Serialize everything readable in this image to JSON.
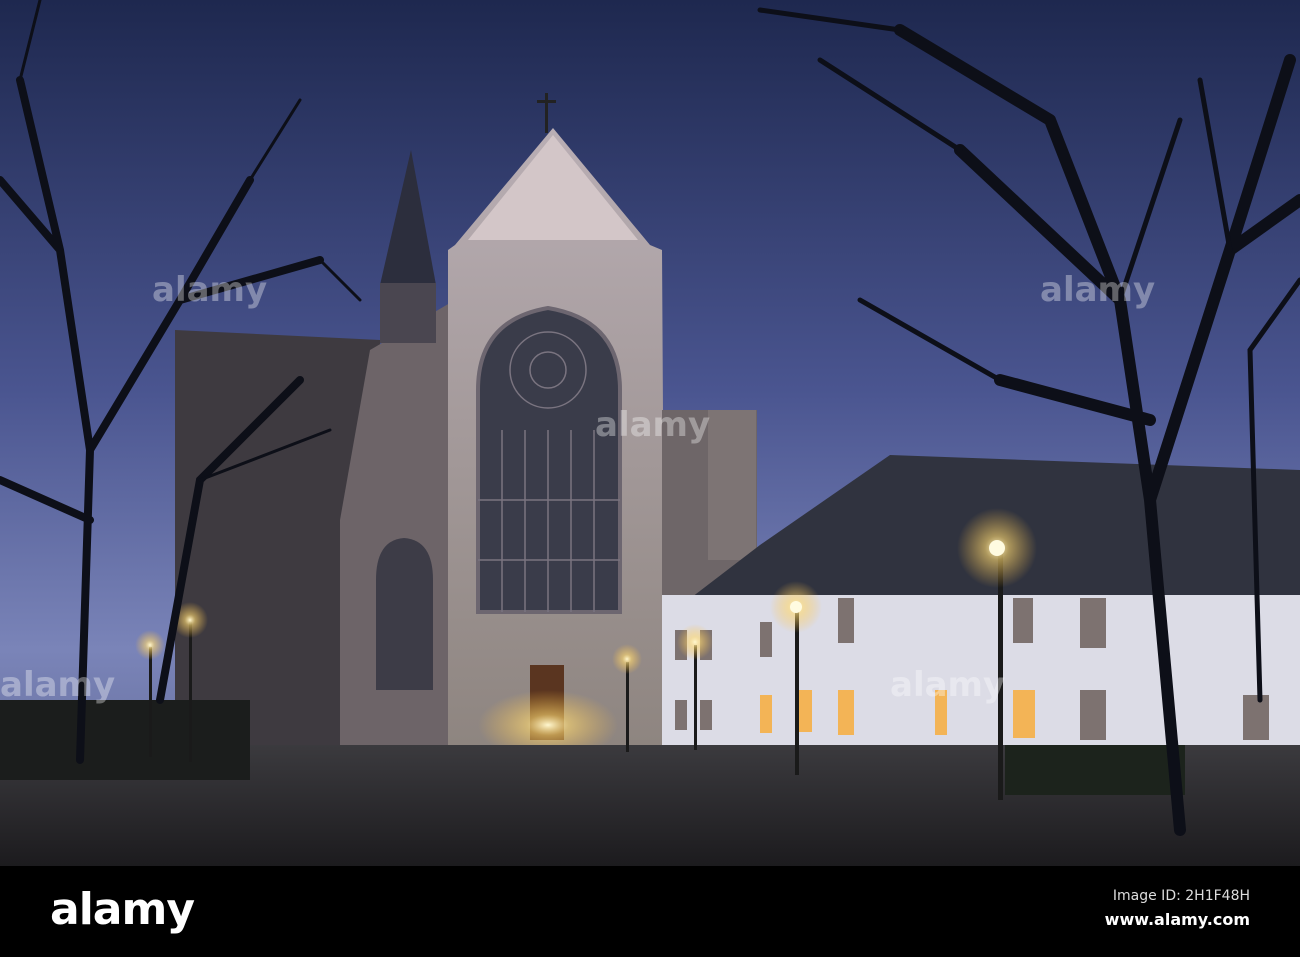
{
  "watermark": {
    "brand": "alamy"
  },
  "footer": {
    "logo": "alamy",
    "image_id": "Image ID: 2H1F48H",
    "url": "www.alamy.com"
  },
  "colors": {
    "sky_top": "#232d55",
    "sky_bottom": "#7b86b8",
    "lamp": "#ffe9a0",
    "wall": "#e9e8f0"
  }
}
